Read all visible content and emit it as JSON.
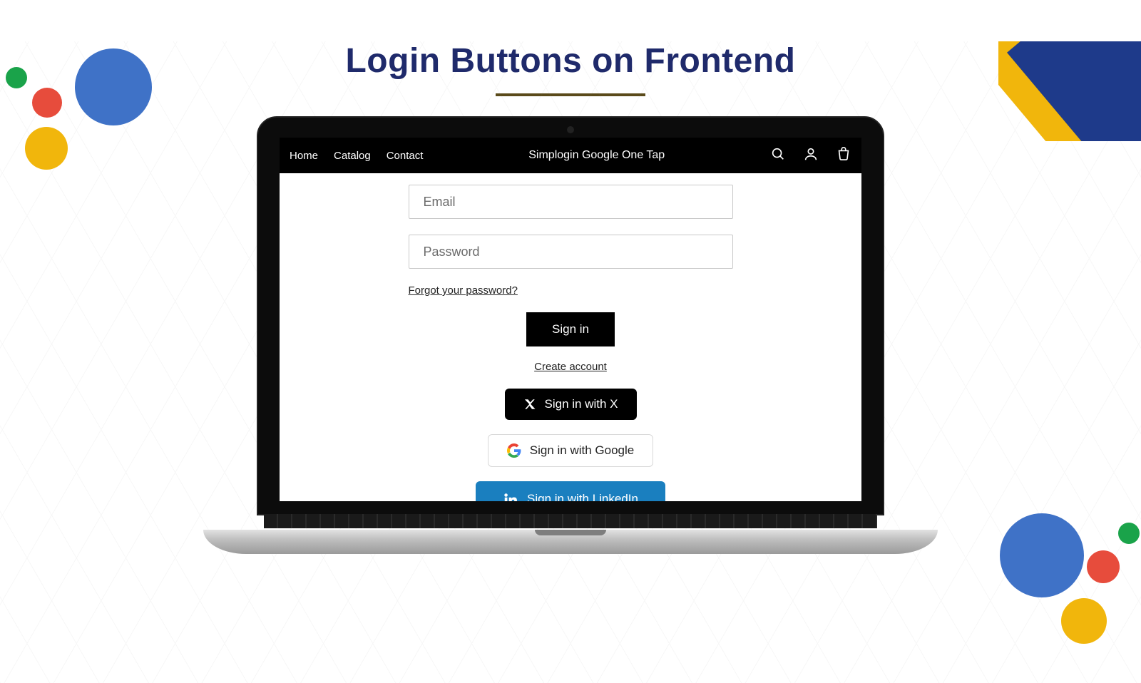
{
  "page": {
    "title": "Login Buttons on Frontend"
  },
  "site": {
    "title": "Simplogin Google One Tap",
    "nav": {
      "home": "Home",
      "catalog": "Catalog",
      "contact": "Contact"
    }
  },
  "login": {
    "email_placeholder": "Email",
    "password_placeholder": "Password",
    "forgot": "Forgot your password?",
    "signin": "Sign in",
    "create": "Create account",
    "x_label": "Sign in with X",
    "google_label": "Sign in with Google",
    "linkedin_label": "Sign in with LinkedIn"
  }
}
